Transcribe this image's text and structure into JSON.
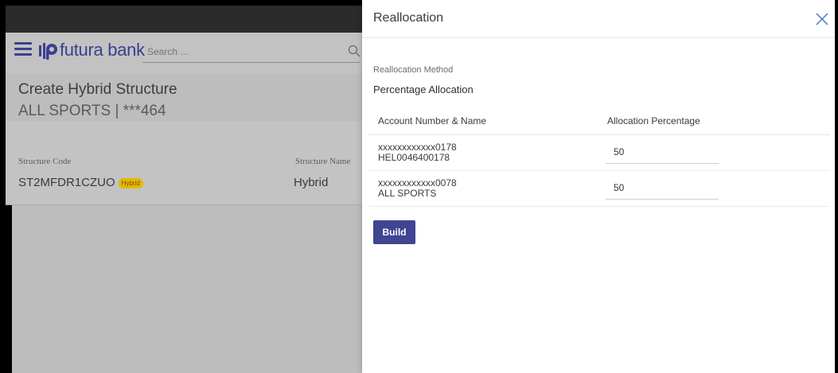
{
  "app": {
    "brand": "futura bank",
    "search": {
      "placeholder": "Search ...",
      "value": ""
    }
  },
  "page": {
    "title": "Create Hybrid Structure",
    "account": "ALL SPORTS | ***464"
  },
  "structure": {
    "code_label": "Structure Code",
    "code_value": "ST2MFDR1CZUO",
    "badge": "Hybrid",
    "name_label": "Structure Name",
    "name_value": "Hybrid"
  },
  "drawer": {
    "title": "Reallocation",
    "method_label": "Reallocation Method",
    "method_value": "Percentage Allocation",
    "columns": [
      "Account Number & Name",
      "Allocation Percentage"
    ],
    "rows": [
      {
        "account_number": "xxxxxxxxxxxx0178",
        "account_name": "HEL0046400178",
        "percentage": "50"
      },
      {
        "account_number": "xxxxxxxxxxxx0078",
        "account_name": "ALL SPORTS",
        "percentage": "50"
      }
    ],
    "build_label": "Build"
  },
  "colors": {
    "brand": "#3a3f8f",
    "button": "#3f4590",
    "badge": "#e6b800",
    "overlay": "#bdbdbd"
  },
  "icons": {
    "menu": "hamburger-icon",
    "logo": "futura-logo-icon",
    "search": "search-icon",
    "close": "close-icon"
  }
}
